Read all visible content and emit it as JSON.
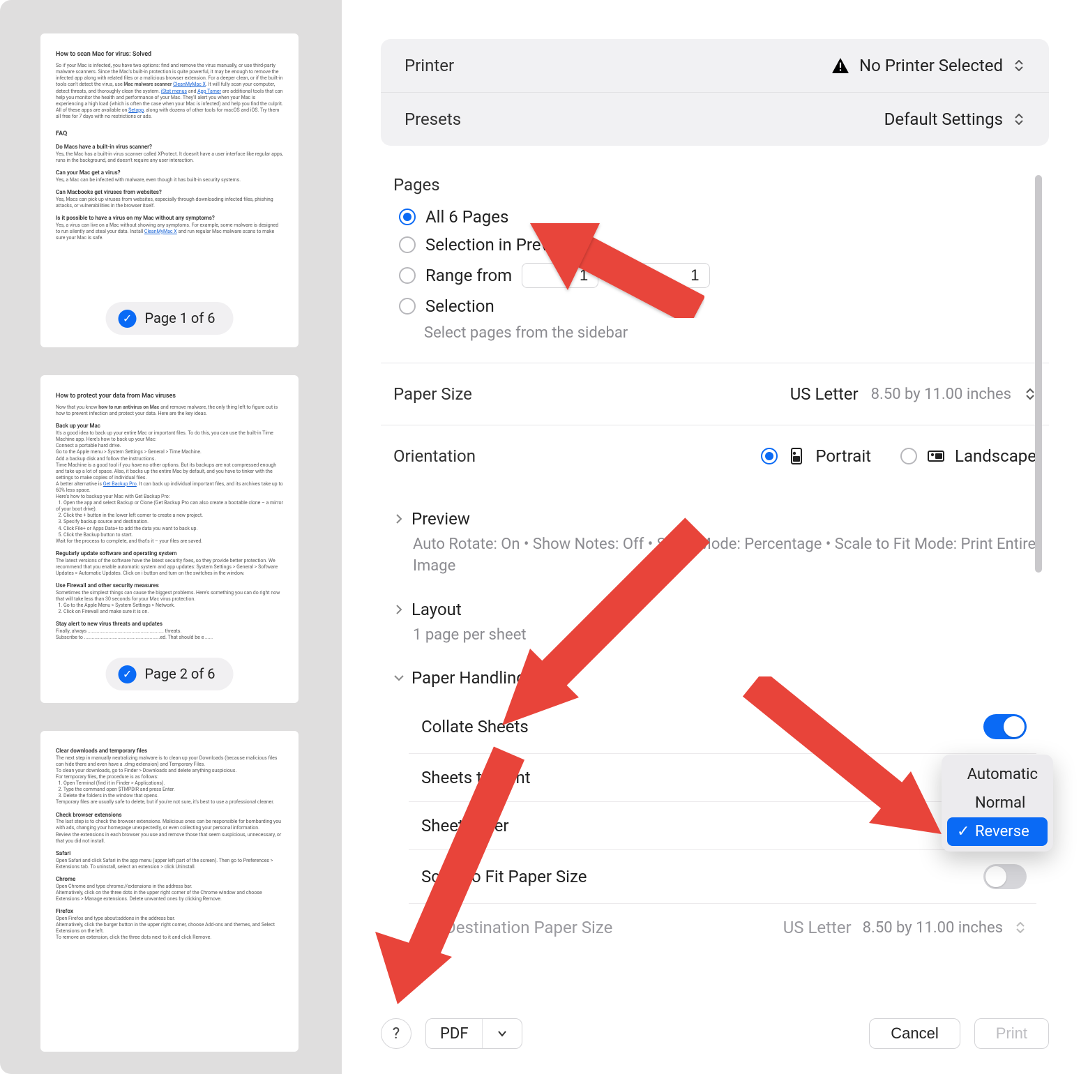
{
  "thumbs": {
    "p1": {
      "title": "How to scan Mac for virus: Solved",
      "badge": "Page 1 of 6",
      "faq": "FAQ",
      "q1": "Do Macs have a built-in virus scanner?",
      "q2": "Can your Mac get a virus?",
      "q3": "Can Macbooks get viruses from websites?",
      "q4": "Is it possible to have a virus on my Mac without any symptoms?"
    },
    "p2": {
      "title": "How to protect your data from Mac viruses",
      "h1": "Back up your Mac",
      "h2": "Regularly update software and operating system",
      "h3": "Use Firewall and other security measures",
      "h4": "Stay alert to new virus threats and updates",
      "badge": "Page 2 of 6"
    },
    "p3": {
      "title": "Clear downloads and temporary files",
      "h1": "Check browser extensions",
      "h2": "Safari",
      "h3": "Chrome",
      "h4": "Firefox"
    }
  },
  "header": {
    "printer_label": "Printer",
    "printer_value": "No Printer Selected",
    "presets_label": "Presets",
    "presets_value": "Default Settings"
  },
  "pages": {
    "label": "Pages",
    "all": "All 6 Pages",
    "sel_prev": "Selection in Preview",
    "range_from": "Range from",
    "range_to": "to",
    "from_val": "1",
    "to_val": "1",
    "selection": "Selection",
    "hint": "Select pages from the sidebar"
  },
  "paper_size": {
    "label": "Paper Size",
    "value": "US Letter",
    "dim": "8.50 by 11.00 inches"
  },
  "orientation": {
    "label": "Orientation",
    "portrait": "Portrait",
    "landscape": "Landscape"
  },
  "preview": {
    "label": "Preview",
    "sub": "Auto Rotate: On • Show Notes: Off • Scale Mode: Percentage • Scale to Fit Mode: Print Entire Image"
  },
  "layout": {
    "label": "Layout",
    "sub": "1 page per sheet"
  },
  "paper_handling": {
    "label": "Paper Handling",
    "collate": "Collate Sheets",
    "sheets_to_print": "Sheets to Print",
    "sheet_order": "Sheet Order",
    "scale_to_fit": "Scale to Fit Paper Size",
    "dest_size": "Destination Paper Size",
    "dest_val": "US Letter",
    "dest_dim": "8.50 by 11.00 inches"
  },
  "menu": {
    "auto": "Automatic",
    "normal": "Normal",
    "reverse": "Reverse"
  },
  "footer": {
    "help": "?",
    "pdf": "PDF",
    "cancel": "Cancel",
    "print": "Print"
  }
}
